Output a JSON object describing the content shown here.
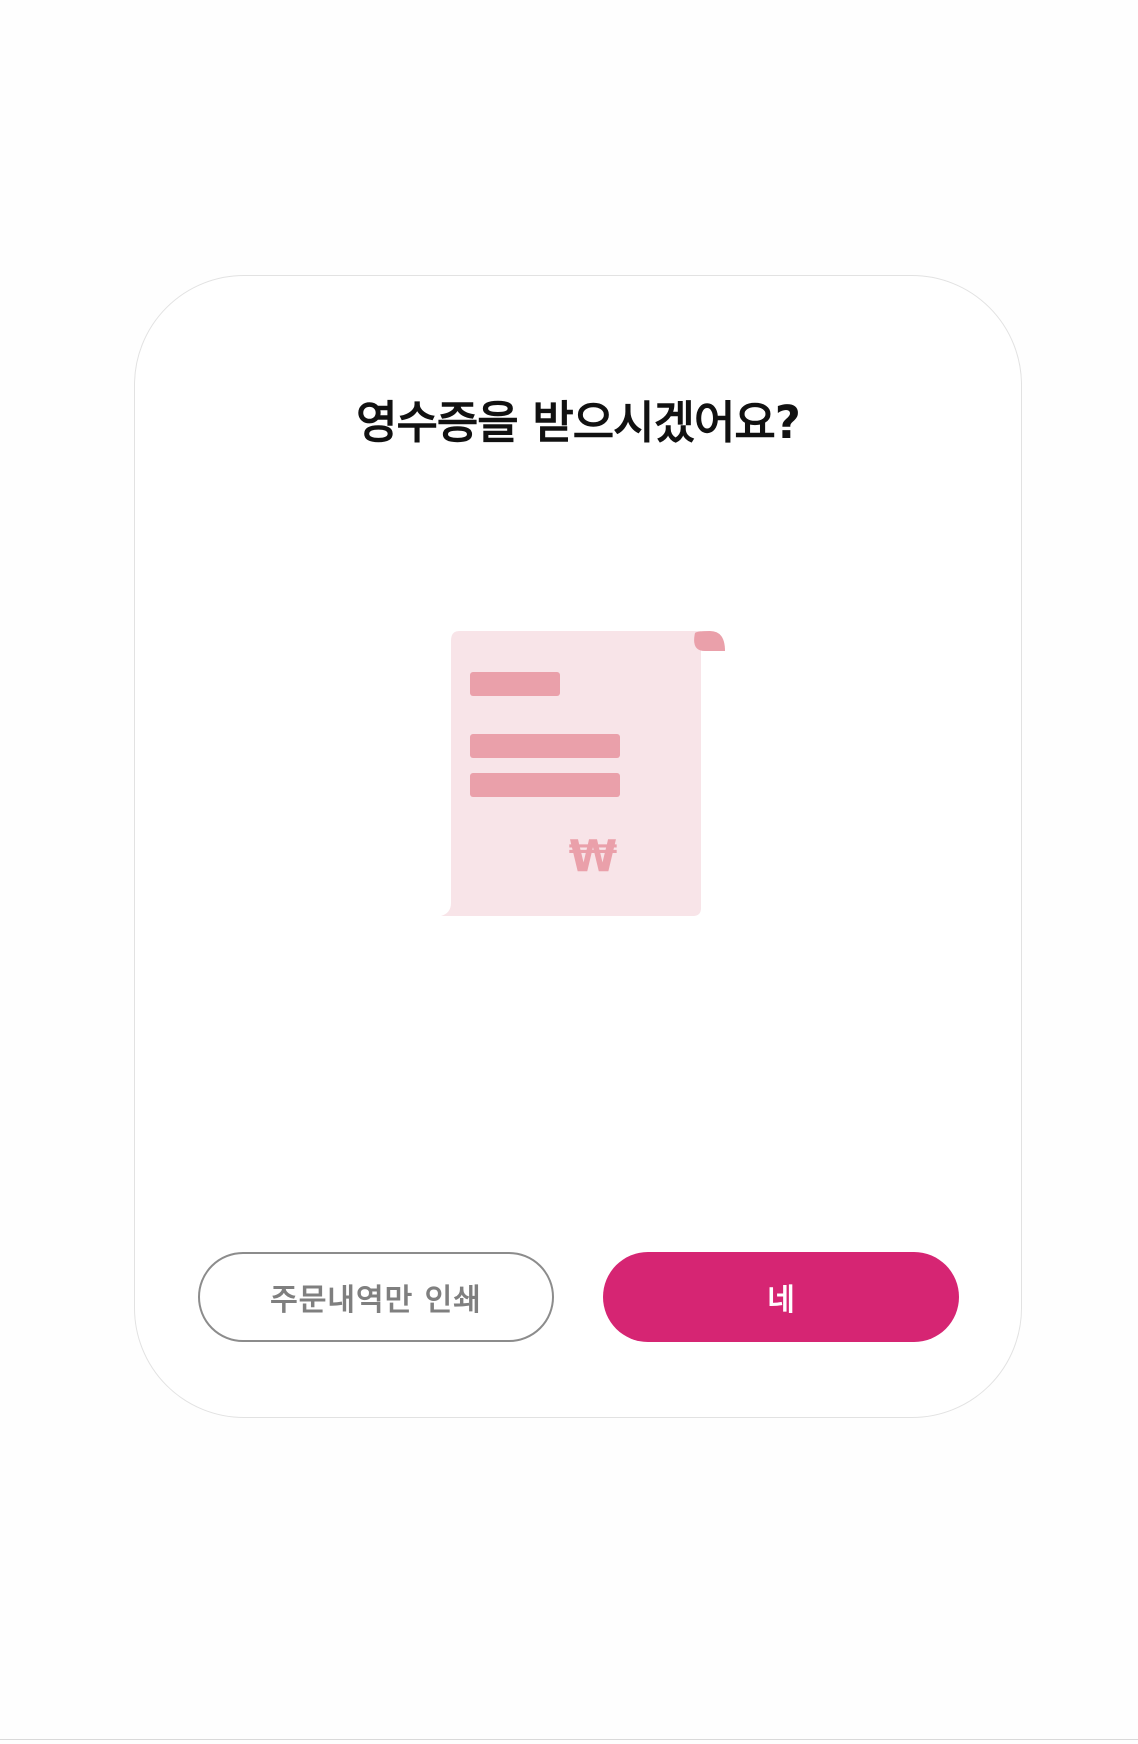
{
  "dialog": {
    "title": "영수증을 받으시겠어요?",
    "currency_symbol": "₩",
    "secondary_button_label": "주문내역만 인쇄",
    "primary_button_label": "네"
  },
  "colors": {
    "accent": "#d62573",
    "receipt_paper": "#f8e4e8",
    "receipt_lines": "#eaa0aa",
    "secondary_border": "#8c8c8c"
  },
  "icons": {
    "receipt": "receipt-icon"
  }
}
